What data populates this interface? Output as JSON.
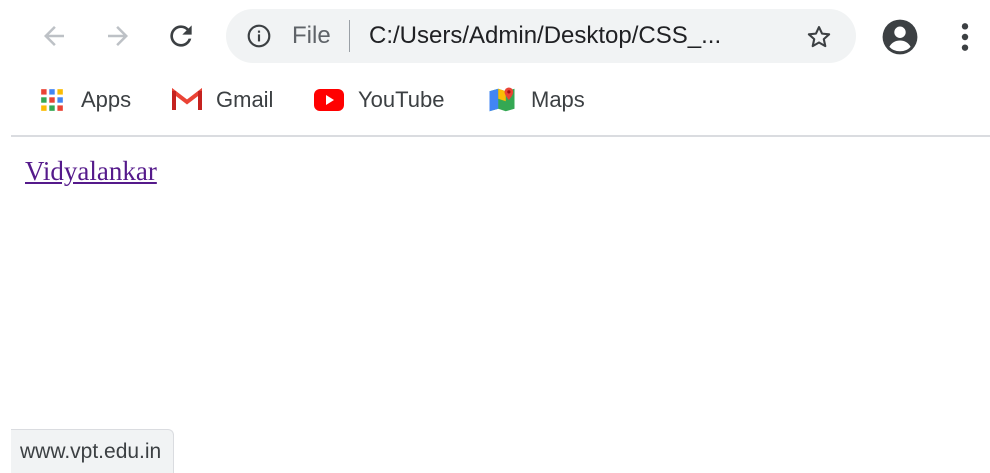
{
  "toolbar": {
    "back_icon": "arrow-left-icon",
    "forward_icon": "arrow-right-icon",
    "reload_icon": "reload-icon"
  },
  "omnibox": {
    "info_icon": "info-icon",
    "scheme_label": "File",
    "url": "C:/Users/Admin/Desktop/CSS_...",
    "star_icon": "star-outline-icon"
  },
  "profile": {
    "icon": "account-circle-icon"
  },
  "menu": {
    "icon": "vertical-dots-icon"
  },
  "bookmarks": [
    {
      "label": "Apps",
      "icon": "apps-grid-icon"
    },
    {
      "label": "Gmail",
      "icon": "gmail-icon"
    },
    {
      "label": "YouTube",
      "icon": "youtube-icon"
    },
    {
      "label": "Maps",
      "icon": "maps-icon"
    }
  ],
  "page": {
    "link_text": "Vidyalankar"
  },
  "status_bar": {
    "url": "www.vpt.edu.in"
  },
  "colors": {
    "visited_link": "#551a8b",
    "omnibox_bg": "#f1f3f4",
    "icon_gray": "#5f6368",
    "gmail_red": "#ea4335",
    "youtube_red": "#ff0000"
  }
}
